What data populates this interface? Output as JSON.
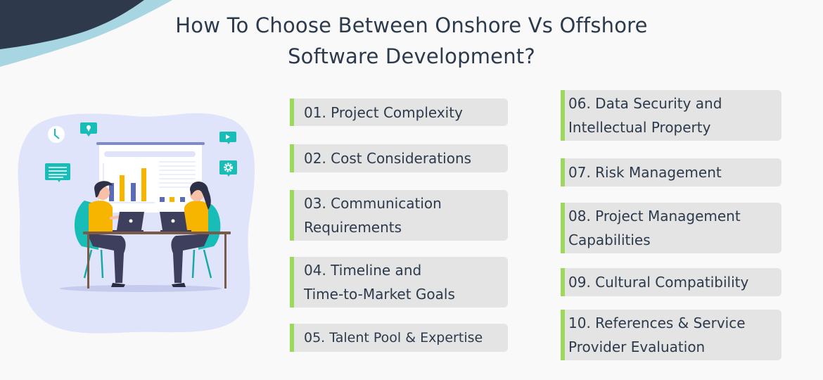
{
  "title": {
    "line1": "How To Choose Between Onshore Vs Offshore",
    "line2": "Software Development?"
  },
  "colors": {
    "accent_green": "#9bd85b",
    "card_bg": "#e4e4e4",
    "text_dark": "#2c3a4b",
    "wave_dark": "#2e3a4b",
    "wave_light": "#a8d5e2",
    "blob": "#dfe4fb",
    "teal": "#19bdb7",
    "yellow": "#f7b500",
    "indigo": "#5b6bb5"
  },
  "illustration": {
    "description": "Two people at a table with laptops in front of a presentation board with bar chart",
    "icons": [
      "clock-icon",
      "location-pin-icon",
      "play-icon",
      "gear-icon",
      "chat-message-icon"
    ]
  },
  "factors_left": [
    {
      "label": "01. Project Complexity"
    },
    {
      "label": "02. Cost Considerations"
    },
    {
      "label": "03. Communication\nRequirements"
    },
    {
      "label": "04. Timeline and\nTime-to-Market Goals"
    },
    {
      "label": "05. Talent Pool & Expertise"
    }
  ],
  "factors_right": [
    {
      "label": "06. Data Security and\nIntellectual Property"
    },
    {
      "label": "07. Risk Management"
    },
    {
      "label": "08. Project Management\nCapabilities"
    },
    {
      "label": "09. Cultural Compatibility"
    },
    {
      "label": "10. References & Service\nProvider Evaluation"
    }
  ]
}
